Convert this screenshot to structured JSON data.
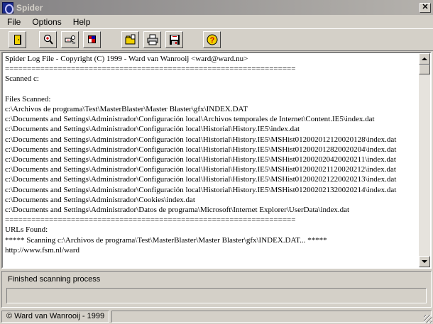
{
  "window": {
    "title": "Spider",
    "close_label": "✕"
  },
  "menu": [
    "File",
    "Options",
    "Help"
  ],
  "toolbar": [
    {
      "name": "open-log-button",
      "icon": "door-icon"
    },
    {
      "name": "scan-button",
      "icon": "magnifier-icon"
    },
    {
      "name": "network-scan-button",
      "icon": "network-icon"
    },
    {
      "name": "stop-button",
      "icon": "stop-icon"
    },
    {
      "name": "save-log-button",
      "icon": "folder-icon"
    },
    {
      "name": "print-button",
      "icon": "printer-icon"
    },
    {
      "name": "save-button",
      "icon": "floppy-icon"
    },
    {
      "name": "help-button",
      "icon": "help-icon"
    }
  ],
  "log_lines": [
    "Spider Log File - Copyright (C) 1999 - Ward van Wanrooij <ward@ward.nu>",
    "==================================================================",
    "Scanned c:",
    "",
    "Files Scanned:",
    "c:\\Archivos de programa\\Test\\MasterBlaster\\Master Blaster\\gfx\\INDEX.DAT",
    "c:\\Documents and Settings\\Administrador\\Configuración local\\Archivos temporales de Internet\\Content.IE5\\index.dat",
    "c:\\Documents and Settings\\Administrador\\Configuración local\\Historial\\History.IE5\\index.dat",
    "c:\\Documents and Settings\\Administrador\\Configuración local\\Historial\\History.IE5\\MSHist012002012120020128\\index.dat",
    "c:\\Documents and Settings\\Administrador\\Configuración local\\Historial\\History.IE5\\MSHist012002012820020204\\index.dat",
    "c:\\Documents and Settings\\Administrador\\Configuración local\\Historial\\History.IE5\\MSHist012002020420020211\\index.dat",
    "c:\\Documents and Settings\\Administrador\\Configuración local\\Historial\\History.IE5\\MSHist012002021120020212\\index.dat",
    "c:\\Documents and Settings\\Administrador\\Configuración local\\Historial\\History.IE5\\MSHist012002021220020213\\index.dat",
    "c:\\Documents and Settings\\Administrador\\Configuración local\\Historial\\History.IE5\\MSHist012002021320020214\\index.dat",
    "c:\\Documents and Settings\\Administrador\\Cookies\\index.dat",
    "c:\\Documents and Settings\\Administrador\\Datos de programa\\Microsoft\\Internet Explorer\\UserData\\index.dat",
    "==================================================================",
    "URLs Found:",
    "***** Scanning c:\\Archivos de programa\\Test\\MasterBlaster\\Master Blaster\\gfx\\INDEX.DAT... *****",
    "http://www.fsm.nl/ward"
  ],
  "status": {
    "message": "Finished scanning process",
    "progress": 0
  },
  "statusbar": {
    "copyright": "© Ward van Wanrooij - 1999"
  }
}
